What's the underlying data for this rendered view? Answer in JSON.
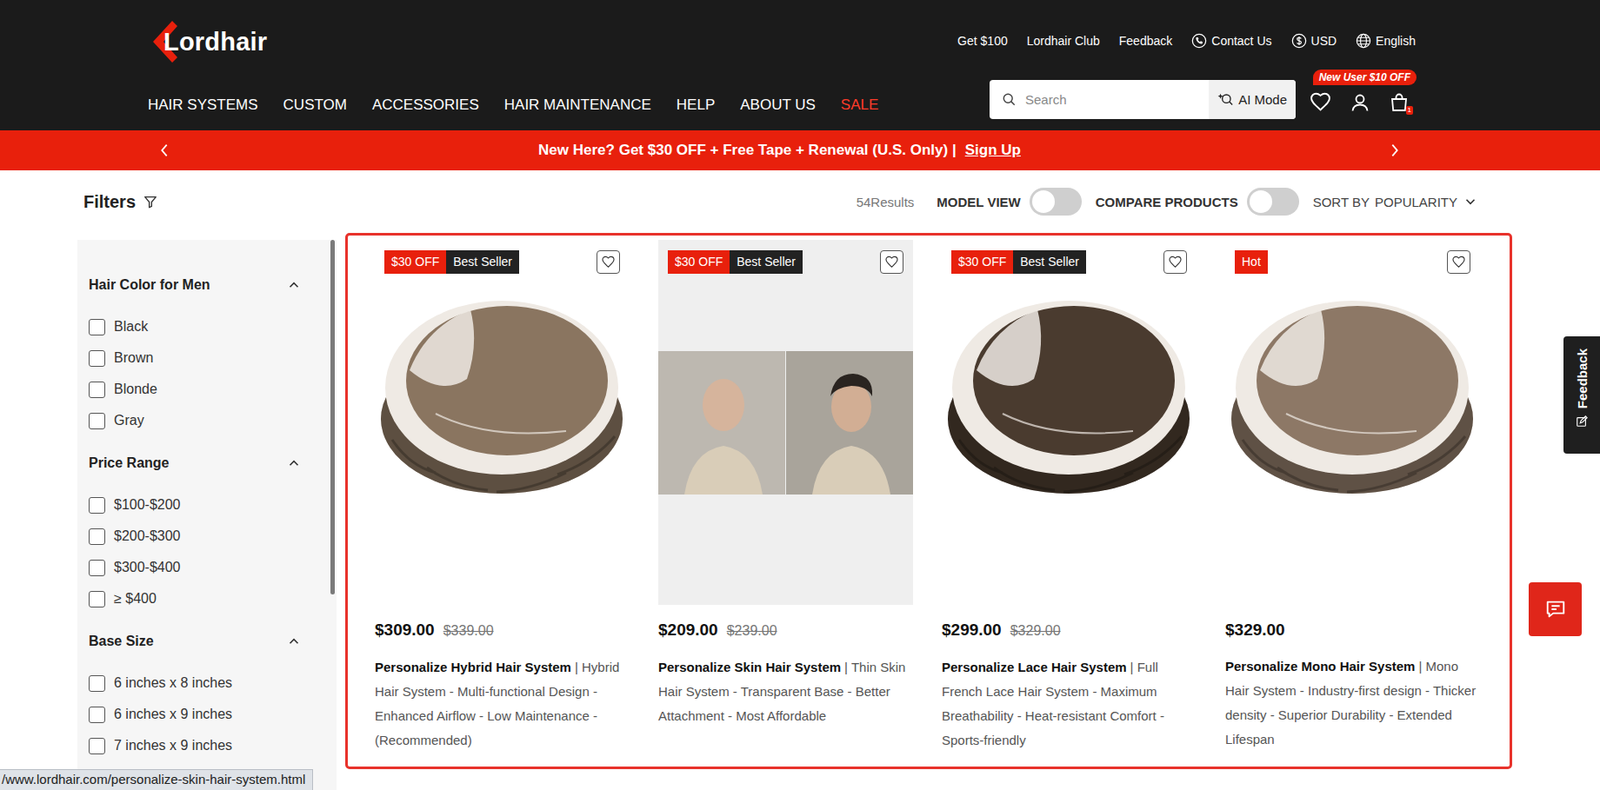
{
  "logo": {
    "text": "Lordhair"
  },
  "top_links": [
    {
      "label": "Get $100",
      "kind": "text"
    },
    {
      "label": "Lordhair Club",
      "kind": "text"
    },
    {
      "label": "Feedback",
      "kind": "text"
    },
    {
      "label": "Contact Us",
      "kind": "phone"
    },
    {
      "label": "USD",
      "kind": "currency"
    },
    {
      "label": "English",
      "kind": "globe"
    }
  ],
  "nav": [
    {
      "label": "HAIR SYSTEMS",
      "highlight": false
    },
    {
      "label": "CUSTOM",
      "highlight": false
    },
    {
      "label": "ACCESSORIES",
      "highlight": false
    },
    {
      "label": "HAIR MAINTENANCE",
      "highlight": false
    },
    {
      "label": "HELP",
      "highlight": false
    },
    {
      "label": "ABOUT US",
      "highlight": false
    },
    {
      "label": "SALE",
      "highlight": true
    }
  ],
  "search": {
    "placeholder": "Search",
    "ai_mode": "AI Mode"
  },
  "promo_badge": "New User $10 OFF",
  "cart": {
    "count": "1"
  },
  "banner": {
    "text": "New Here? Get $30 OFF + Free Tape + Renewal (U.S. Only) |",
    "link": "Sign Up"
  },
  "toolbar": {
    "filters": "Filters",
    "results": "54Results",
    "model_view": {
      "label": "MODEL VIEW",
      "on": false
    },
    "compare": {
      "label": "COMPARE PRODUCTS",
      "on": false
    },
    "sort": {
      "label": "SORT BY",
      "value": "POPULARITY"
    }
  },
  "filters": [
    {
      "title": "Hair Color for Men",
      "expanded": true,
      "options": [
        {
          "label": "Black",
          "checked": false
        },
        {
          "label": "Brown",
          "checked": false
        },
        {
          "label": "Blonde",
          "checked": false
        },
        {
          "label": "Gray",
          "checked": false
        }
      ]
    },
    {
      "title": "Price Range",
      "expanded": true,
      "options": [
        {
          "label": "$100-$200",
          "checked": false
        },
        {
          "label": "$200-$300",
          "checked": false
        },
        {
          "label": "$300-$400",
          "checked": false
        },
        {
          "label": "≥ $400",
          "checked": false
        }
      ]
    },
    {
      "title": "Base Size",
      "expanded": true,
      "options": [
        {
          "label": "6 inches x 8 inches",
          "checked": false
        },
        {
          "label": "6 inches x 9 inches",
          "checked": false
        },
        {
          "label": "7 inches x 9 inches",
          "checked": false
        }
      ]
    }
  ],
  "products": [
    {
      "badges": [
        {
          "label": "$30 OFF",
          "kind": "discount"
        },
        {
          "label": "Best Seller",
          "kind": "bestseller"
        }
      ],
      "image": {
        "kind": "hairpiece",
        "color": "#8a7560"
      },
      "hovered": false,
      "favorited": false,
      "price": "$309.00",
      "old_price": "$339.00",
      "title": "Personalize Hybrid Hair System",
      "subtitle": "| Hybrid Hair System - Multi-functional Design - Enhanced Airflow - Low Maintenance - (Recommended)"
    },
    {
      "badges": [
        {
          "label": "$30 OFF",
          "kind": "discount"
        },
        {
          "label": "Best Seller",
          "kind": "bestseller"
        }
      ],
      "image": {
        "kind": "photo",
        "color": "#bdb8b0"
      },
      "hovered": true,
      "favorited": false,
      "price": "$209.00",
      "old_price": "$239.00",
      "title": "Personalize Skin Hair System",
      "subtitle": "| Thin Skin Hair System - Transparent Base - Better Attachment - Most Affordable"
    },
    {
      "badges": [
        {
          "label": "$30 OFF",
          "kind": "discount"
        },
        {
          "label": "Best Seller",
          "kind": "bestseller"
        }
      ],
      "image": {
        "kind": "hairpiece",
        "color": "#4a3b2f"
      },
      "hovered": false,
      "favorited": false,
      "price": "$299.00",
      "old_price": "$329.00",
      "title": "Personalize Lace Hair System",
      "subtitle": "| Full French Lace Hair System - Maximum Breathability - Heat-resistant Comfort - Sports-friendly"
    },
    {
      "badges": [
        {
          "label": "Hot",
          "kind": "hot"
        }
      ],
      "image": {
        "kind": "hairpiece",
        "color": "#8d7866"
      },
      "hovered": false,
      "favorited": false,
      "price": "$329.00",
      "title": "Personalize Mono Hair System",
      "subtitle": "| Mono Hair System - Industry-first design - Thicker density - Superior Durability - Extended Lifespan"
    }
  ],
  "side_tab": {
    "label": "Feedback"
  },
  "status_url": "/www.lordhair.com/personalize-skin-hair-system.html"
}
